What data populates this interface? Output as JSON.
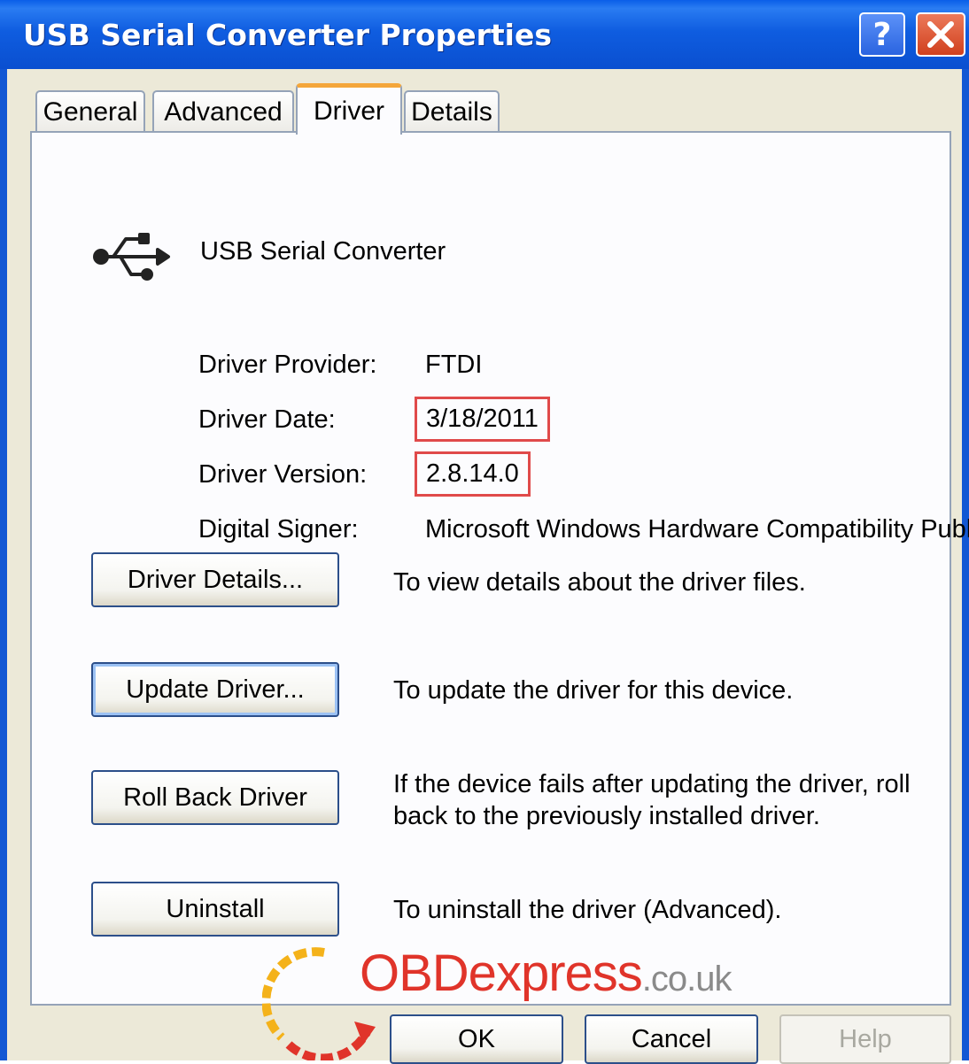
{
  "window": {
    "title": "USB Serial Converter Properties"
  },
  "tabs": [
    {
      "label": "General"
    },
    {
      "label": "Advanced"
    },
    {
      "label": "Driver"
    },
    {
      "label": "Details"
    }
  ],
  "active_tab": "Driver",
  "device": {
    "name": "USB Serial Converter",
    "icon": "usb-icon"
  },
  "driver_info": {
    "provider_label": "Driver Provider:",
    "provider": "FTDI",
    "date_label": "Driver Date:",
    "date": "3/18/2011",
    "version_label": "Driver Version:",
    "version": "2.8.14.0",
    "signer_label": "Digital Signer:",
    "signer": "Microsoft Windows Hardware Compatibility Publ"
  },
  "actions": [
    {
      "button": "Driver Details...",
      "description": "To view details about the driver files."
    },
    {
      "button": "Update Driver...",
      "description": "To update the driver for this device."
    },
    {
      "button": "Roll Back Driver",
      "description": "If the device fails after updating the driver, roll back to the previously installed driver."
    },
    {
      "button": "Uninstall",
      "description": "To uninstall the driver (Advanced)."
    }
  ],
  "footer": {
    "ok": "OK",
    "cancel": "Cancel",
    "help": "Help"
  },
  "watermark": {
    "brand": "OBDexpress",
    "domain": ".co.uk"
  },
  "colors": {
    "titlebar": "#0a5ee8",
    "highlight_box": "#e04a4a",
    "dialog_bg": "#ece9d8",
    "active_tab_accent": "#f4a63a"
  }
}
